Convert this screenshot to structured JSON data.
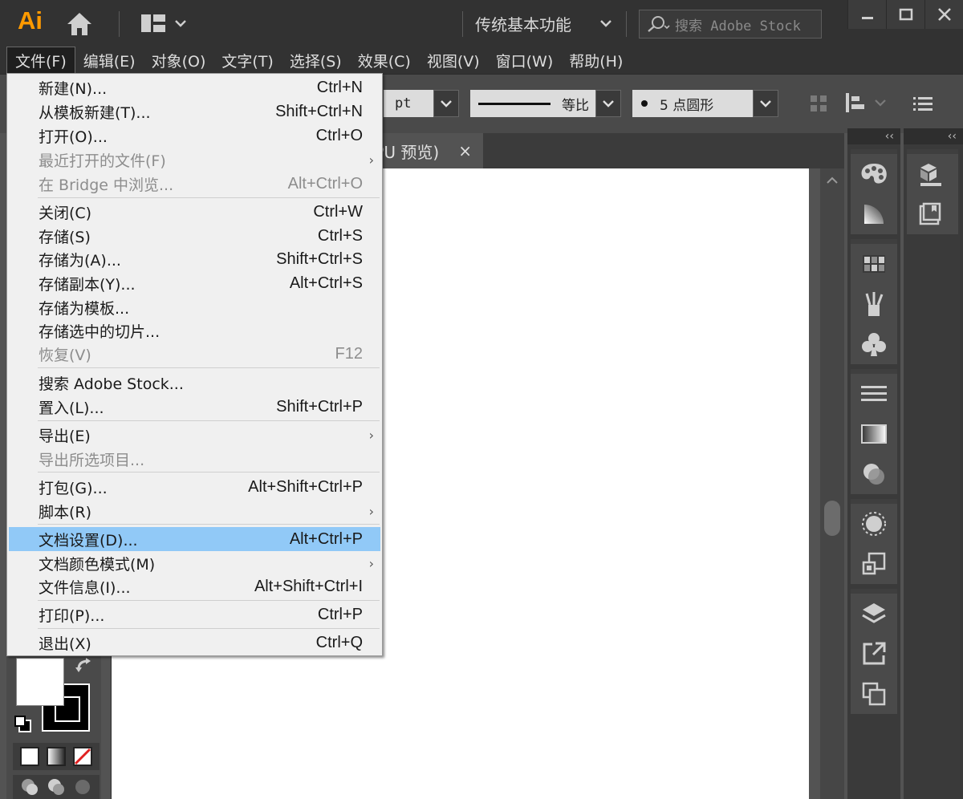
{
  "app": {
    "logo": "Ai",
    "workspace": "传统基本功能",
    "search_placeholder": "搜索 Adobe Stock"
  },
  "menubar": [
    "文件(F)",
    "编辑(E)",
    "对象(O)",
    "文字(T)",
    "选择(S)",
    "效果(C)",
    "视图(V)",
    "窗口(W)",
    "帮助(H)"
  ],
  "controlbar": {
    "stroke_unit": "pt",
    "profile_label": "等比",
    "brush_label": "5 点圆形"
  },
  "document_tab": {
    "label": "PU 预览)",
    "close": "×"
  },
  "file_menu": {
    "items": [
      {
        "label": "新建(N)...",
        "shortcut": "Ctrl+N",
        "state": "normal"
      },
      {
        "label": "从模板新建(T)...",
        "shortcut": "Shift+Ctrl+N",
        "state": "normal"
      },
      {
        "label": "打开(O)...",
        "shortcut": "Ctrl+O",
        "state": "normal"
      },
      {
        "label": "最近打开的文件(F)",
        "shortcut": "",
        "state": "disabled",
        "submenu": true
      },
      {
        "label": "在 Bridge 中浏览...",
        "shortcut": "Alt+Ctrl+O",
        "state": "disabled"
      },
      {
        "label": "关闭(C)",
        "shortcut": "Ctrl+W",
        "state": "normal"
      },
      {
        "label": "存储(S)",
        "shortcut": "Ctrl+S",
        "state": "normal"
      },
      {
        "label": "存储为(A)...",
        "shortcut": "Shift+Ctrl+S",
        "state": "normal"
      },
      {
        "label": "存储副本(Y)...",
        "shortcut": "Alt+Ctrl+S",
        "state": "normal"
      },
      {
        "label": "存储为模板...",
        "shortcut": "",
        "state": "normal"
      },
      {
        "label": "存储选中的切片...",
        "shortcut": "",
        "state": "normal"
      },
      {
        "label": "恢复(V)",
        "shortcut": "F12",
        "state": "disabled"
      },
      {
        "label": "搜索 Adobe Stock...",
        "shortcut": "",
        "state": "normal"
      },
      {
        "label": "置入(L)...",
        "shortcut": "Shift+Ctrl+P",
        "state": "normal"
      },
      {
        "label": "导出(E)",
        "shortcut": "",
        "state": "normal",
        "submenu": true
      },
      {
        "label": "导出所选项目...",
        "shortcut": "",
        "state": "disabled"
      },
      {
        "label": "打包(G)...",
        "shortcut": "Alt+Shift+Ctrl+P",
        "state": "normal"
      },
      {
        "label": "脚本(R)",
        "shortcut": "",
        "state": "normal",
        "submenu": true
      },
      {
        "label": "文档设置(D)...",
        "shortcut": "Alt+Ctrl+P",
        "state": "highlight"
      },
      {
        "label": "文档颜色模式(M)",
        "shortcut": "",
        "state": "normal",
        "submenu": true
      },
      {
        "label": "文件信息(I)...",
        "shortcut": "Alt+Shift+Ctrl+I",
        "state": "normal"
      },
      {
        "label": "打印(P)...",
        "shortcut": "Ctrl+P",
        "state": "normal"
      },
      {
        "label": "退出(X)",
        "shortcut": "Ctrl+Q",
        "state": "normal"
      }
    ],
    "submenu_glyph": "›"
  },
  "panels": {
    "collapse_glyph": "‹‹",
    "dock1_icons": [
      "palette-icon",
      "color-guide-icon",
      "swatches-icon",
      "brushes-icon",
      "symbols-icon",
      "stroke-icon",
      "gradient-icon",
      "transparency-icon",
      "appearance-icon",
      "graphic-styles-icon",
      "layers-icon",
      "artboards-icon",
      "asset-export-icon"
    ],
    "dock2_icons": [
      "3d-cube-icon",
      "libraries-icon"
    ]
  },
  "colors": {
    "accent_logo": "#ff9a00",
    "menu_highlight": "#91c9f7",
    "chrome_dark": "#323232",
    "chrome_mid": "#535353"
  }
}
